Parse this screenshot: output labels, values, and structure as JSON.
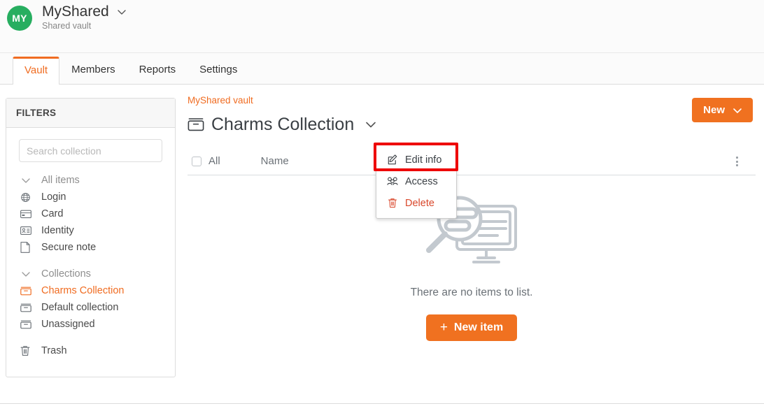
{
  "header": {
    "avatar_initials": "MY",
    "org_name": "MyShared",
    "org_subtitle": "Shared vault",
    "chevron_icon": "chevron-down-icon"
  },
  "tabs": [
    {
      "label": "Vault",
      "active": true
    },
    {
      "label": "Members",
      "active": false
    },
    {
      "label": "Reports",
      "active": false
    },
    {
      "label": "Settings",
      "active": false
    }
  ],
  "sidebar": {
    "title": "FILTERS",
    "search": {
      "placeholder": "Search collection",
      "value": ""
    },
    "filters": [
      {
        "label": "All items",
        "icon": "chevron-down-icon",
        "state": "muted"
      },
      {
        "label": "Login",
        "icon": "globe-icon",
        "state": "normal"
      },
      {
        "label": "Card",
        "icon": "card-icon",
        "state": "normal"
      },
      {
        "label": "Identity",
        "icon": "identity-icon",
        "state": "normal"
      },
      {
        "label": "Secure note",
        "icon": "note-icon",
        "state": "normal"
      }
    ],
    "collections_group": {
      "label": "Collections",
      "icon": "chevron-down-icon"
    },
    "collections": [
      {
        "label": "Charms Collection",
        "icon": "collection-icon",
        "state": "active"
      },
      {
        "label": "Default collection",
        "icon": "collection-icon",
        "state": "normal"
      },
      {
        "label": "Unassigned",
        "icon": "collection-icon",
        "state": "normal"
      }
    ],
    "trash": {
      "label": "Trash",
      "icon": "trash-icon"
    }
  },
  "main": {
    "breadcrumb": "MyShared vault",
    "page_title": "Charms Collection",
    "title_icon": "collection-icon",
    "title_chevron_icon": "chevron-down-icon",
    "new_button": {
      "label": "New",
      "chevron_icon": "chevron-down-icon"
    },
    "table": {
      "select_all_label": "All",
      "columns": [
        "Name"
      ],
      "rows": [],
      "options_icon": "kebab-menu-icon"
    },
    "empty_state": {
      "illustration": "magnifier-over-monitor-icon",
      "message": "There are no items to list.",
      "action_label": "New item",
      "action_icon": "plus-icon"
    }
  },
  "dropdown": {
    "visible": true,
    "items": [
      {
        "label": "Edit info",
        "icon": "edit-pencil-icon",
        "variant": "default",
        "highlighted": true
      },
      {
        "label": "Access",
        "icon": "people-icon",
        "variant": "default",
        "highlighted": false
      },
      {
        "label": "Delete",
        "icon": "trash-icon",
        "variant": "danger",
        "highlighted": false
      }
    ]
  },
  "colors": {
    "accent_orange": "#f07120",
    "avatar_green": "#27ae60",
    "danger_red": "#d9472b",
    "highlight_red": "#ee0000",
    "muted_gray": "#8e8e8e"
  }
}
